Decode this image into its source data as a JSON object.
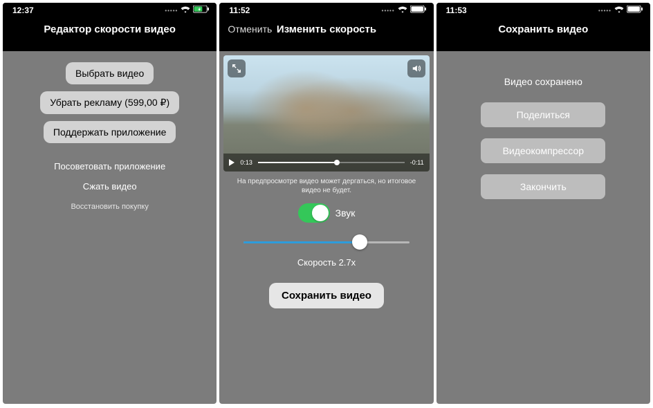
{
  "screens": [
    {
      "time": "12:37",
      "title": "Редактор скорости видео",
      "battery": "charging",
      "buttons": {
        "select": "Выбрать видео",
        "remove_ads": "Убрать рекламу (599,00 ₽)",
        "support": "Поддержать приложение"
      },
      "links": {
        "recommend": "Посоветовать приложение",
        "compress": "Сжать видео",
        "restore": "Восстановить покупку"
      }
    },
    {
      "time": "11:52",
      "cancel": "Отменить",
      "title": "Изменить скорость",
      "player": {
        "elapsed": "0:13",
        "remaining": "-0:11"
      },
      "hint": "На предпросмотре видео может дергаться, но итоговое видео не будет.",
      "sound_label": "Звук",
      "speed_label": "Скорость 2.7x",
      "save": "Сохранить видео"
    },
    {
      "time": "11:53",
      "title": "Сохранить видео",
      "message": "Видео сохранено",
      "buttons": {
        "share": "Поделиться",
        "compressor": "Видеокомпрессор",
        "finish": "Закончить"
      }
    }
  ]
}
